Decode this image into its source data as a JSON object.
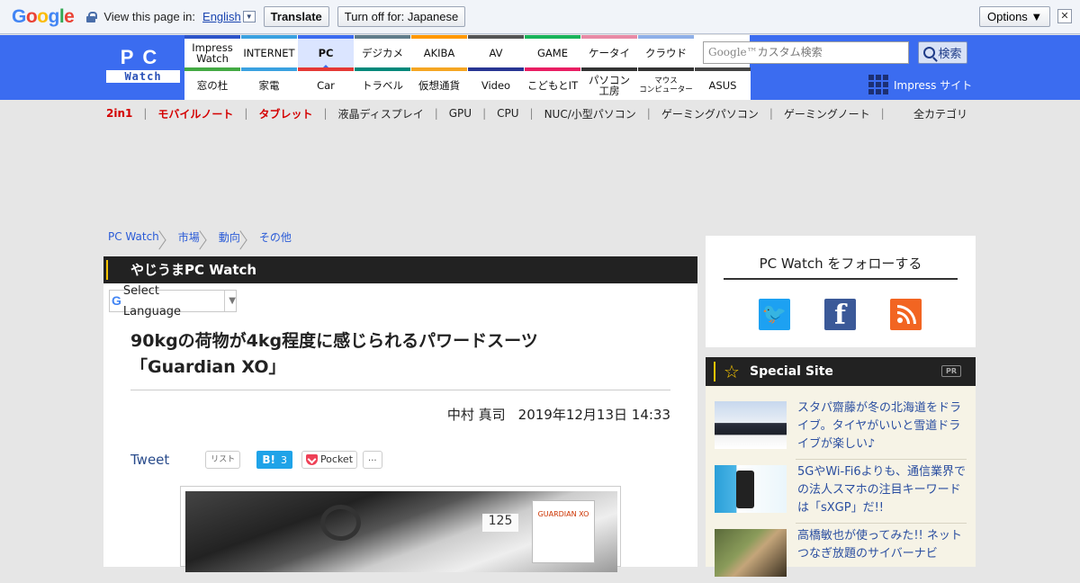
{
  "translate_bar": {
    "logo": [
      "G",
      "o",
      "o",
      "g",
      "l",
      "e"
    ],
    "logo_colors": [
      "#4285f4",
      "#ea4335",
      "#fbbc05",
      "#4285f4",
      "#34a853",
      "#ea4335"
    ],
    "prompt": "View this page in:",
    "language": "English",
    "dropdown_glyph": "▼",
    "translate_button": "Translate",
    "turn_off_button": "Turn off for: Japanese",
    "options_button": "Options ▼",
    "close_glyph": "✕"
  },
  "header": {
    "logo_top": "PC",
    "logo_bottom": "Watch",
    "nav_row1": [
      {
        "label": "Impress\nWatch",
        "color": "#2d55c9"
      },
      {
        "label": "INTERNET",
        "color": "#3aa1e0"
      },
      {
        "label": "PC",
        "color": "#3b6cf0"
      },
      {
        "label": "デジカメ",
        "color": "#607d8b"
      },
      {
        "label": "AKIBA",
        "color": "#ff9800"
      },
      {
        "label": "AV",
        "color": "#555555"
      },
      {
        "label": "GAME",
        "color": "#19b35a"
      },
      {
        "label": "ケータイ",
        "color": "#e88aa6"
      },
      {
        "label": "クラウド",
        "color": "#8fb0e8"
      }
    ],
    "nav_row2": [
      {
        "label": "窓の杜",
        "color": "#44aa44"
      },
      {
        "label": "家電",
        "color": "#3aa1e0"
      },
      {
        "label": "Car",
        "color": "#e53935"
      },
      {
        "label": "トラベル",
        "color": "#00897b"
      },
      {
        "label": "仮想通貨",
        "color": "#f5a623"
      },
      {
        "label": "Video",
        "color": "#283593"
      },
      {
        "label": "こどもとIT",
        "color": "#e91e63"
      },
      {
        "label": "パソコン\n工房",
        "color": "#333333"
      },
      {
        "label": "マウス\nコンピューター",
        "color": "#333333"
      },
      {
        "label": "ASUS",
        "color": "#444444"
      }
    ],
    "search_placeholder_brand": "Google™",
    "search_placeholder": "カスタム検索",
    "search_button": "検索",
    "impress_link": "Impress サイト"
  },
  "categories": [
    {
      "label": "2in1",
      "highlight": true
    },
    {
      "label": "モバイルノート",
      "highlight": true
    },
    {
      "label": "タブレット",
      "highlight": true
    },
    {
      "label": "液晶ディスプレイ",
      "highlight": false
    },
    {
      "label": "GPU",
      "highlight": false
    },
    {
      "label": "CPU",
      "highlight": false
    },
    {
      "label": "NUC/小型パソコン",
      "highlight": false
    },
    {
      "label": "ゲーミングパソコン",
      "highlight": false
    },
    {
      "label": "ゲーミングノート",
      "highlight": false
    }
  ],
  "all_categories": "全カテゴリ",
  "breadcrumb": [
    "PC Watch",
    "市場",
    "動向",
    "その他"
  ],
  "article": {
    "section": "やじうまPC Watch",
    "select_language": "Select Language",
    "title_line1": "90kgの荷物が4kg程度に感じられるパワードスーツ",
    "title_line2": "「Guardian XO」",
    "author": "中村 真司",
    "date": "2019年12月13日 14:33",
    "tweet": "Tweet",
    "list": "リスト",
    "hatena": "B!",
    "hatena_count": "3",
    "pocket": "Pocket",
    "more": "...",
    "photo_sign": "125",
    "photo_board": "GUARDIAN XO"
  },
  "sidebar": {
    "follow_title": "PC Watch をフォローする",
    "special_title": "Special Site",
    "pr": "PR",
    "items": [
      {
        "text": "スタパ齋藤が冬の北海道をドライブ。タイヤがいいと雪道ドライブが楽しい♪"
      },
      {
        "text": "5GやWi-Fi6よりも、通信業界での法人スマホの注目キーワードは「sXGP」だ!!"
      },
      {
        "text": "高橋敏也が使ってみた!! ネットつなぎ放題のサイバーナビ"
      }
    ]
  }
}
